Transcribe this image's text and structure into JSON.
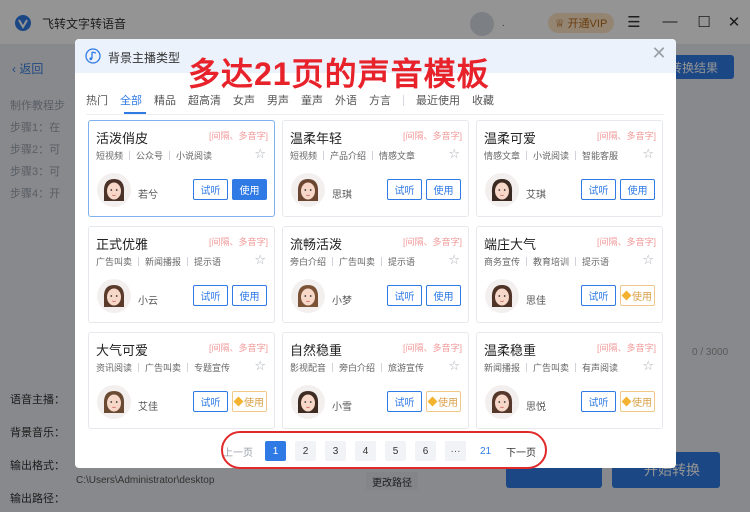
{
  "app": {
    "title": "飞转文字转语音",
    "avatar_dot": ".",
    "vip_label": "开通VIP",
    "back_label": "返回",
    "convert_result_label": "转换结果",
    "steps": [
      "制作教程步",
      "步骤1：在",
      "步骤2：可",
      "步骤3：可",
      "步骤4：开"
    ],
    "counter": "0 / 3000",
    "bottom_labels": [
      "语音主播：",
      "背景音乐：",
      "输出格式：",
      "输出路径："
    ],
    "output_path": "C:\\Users\\Administrator\\desktop",
    "change_path_label": "更改路径",
    "start_label": "开始转换",
    "colors": {
      "accent": "#2f7ae5",
      "vip": "#ffe4c4"
    }
  },
  "modal": {
    "title": "背景主播类型",
    "headline": "多达21页的声音模板",
    "close_icon": "close-icon",
    "tabs": [
      "热门",
      "全部",
      "精品",
      "超高清",
      "女声",
      "男声",
      "童声",
      "外语",
      "方言",
      "最近使用",
      "收藏"
    ],
    "active_tab": "全部",
    "voices": [
      {
        "name": "活泼俏皮",
        "badge": "[间隔、多音字]",
        "tags": [
          "短视频",
          "公众号",
          "小说阅读"
        ],
        "speaker": "若兮",
        "listen": "试听",
        "use": "使用",
        "vip": false
      },
      {
        "name": "温柔年轻",
        "badge": "[间隔、多音字]",
        "tags": [
          "短视频",
          "产品介绍",
          "情感文章"
        ],
        "speaker": "思琪",
        "listen": "试听",
        "use": "使用",
        "vip": false
      },
      {
        "name": "温柔可爱",
        "badge": "[间隔、多音字]",
        "tags": [
          "情感文章",
          "小说阅读",
          "智能客服"
        ],
        "speaker": "艾琪",
        "listen": "试听",
        "use": "使用",
        "vip": false
      },
      {
        "name": "正式优雅",
        "badge": "[间隔、多音字]",
        "tags": [
          "广告叫卖",
          "新闻播报",
          "提示语"
        ],
        "speaker": "小云",
        "listen": "试听",
        "use": "使用",
        "vip": false
      },
      {
        "name": "流畅活泼",
        "badge": "[间隔、多音字]",
        "tags": [
          "旁白介绍",
          "广告叫卖",
          "提示语"
        ],
        "speaker": "小梦",
        "listen": "试听",
        "use": "使用",
        "vip": false
      },
      {
        "name": "端庄大气",
        "badge": "[间隔、多音字]",
        "tags": [
          "商务宣传",
          "教育培训",
          "提示语"
        ],
        "speaker": "思佳",
        "listen": "试听",
        "use": "使用",
        "vip": true
      },
      {
        "name": "大气可爱",
        "badge": "[间隔、多音字]",
        "tags": [
          "资讯阅读",
          "广告叫卖",
          "专题宣传"
        ],
        "speaker": "艾佳",
        "listen": "试听",
        "use": "使用",
        "vip": true
      },
      {
        "name": "自然稳重",
        "badge": "[间隔、多音字]",
        "tags": [
          "影视配音",
          "旁白介绍",
          "旅游宣传"
        ],
        "speaker": "小雪",
        "listen": "试听",
        "use": "使用",
        "vip": true
      },
      {
        "name": "温柔稳重",
        "badge": "[间隔、多音字]",
        "tags": [
          "新闻播报",
          "广告叫卖",
          "有声阅读"
        ],
        "speaker": "思悦",
        "listen": "试听",
        "use": "使用",
        "vip": true
      }
    ],
    "pagination": {
      "prev": "上一页",
      "pages": [
        "1",
        "2",
        "3",
        "4",
        "5",
        "6"
      ],
      "current": "1",
      "ellipsis": "···",
      "last": "21",
      "next": "下一页"
    }
  }
}
